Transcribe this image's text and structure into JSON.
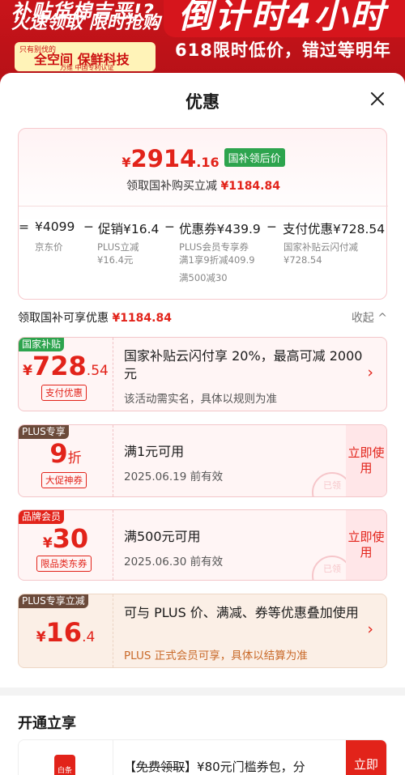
{
  "banner": {
    "left_line1": "补贴货棉吉恶!?",
    "left_line2": "火速领取 限时抢购",
    "shop_small": "只有别伐的",
    "shop_brand": "全空间 保鲜科技",
    "shop_sub": "万维 中国专利认证",
    "countdown": "倒计时4小时",
    "slogan": "618限时低价，错过等明年"
  },
  "sheet": {
    "title": "优惠"
  },
  "summary": {
    "price_symbol": "¥",
    "price_int": "2914",
    "price_dec": ".16",
    "price_tag": "国补领后价",
    "sub_text": "领取国补购买立减",
    "sub_amount": "¥1184.84",
    "formula": {
      "eq": "=",
      "jd_price": "¥4099",
      "minus1": "−",
      "promo": "促销¥16.4",
      "minus2": "−",
      "coupon": "优惠券¥439.9",
      "minus3": "−",
      "pay": "支付优惠¥728.54"
    },
    "notes": {
      "jd_price_label": "京东价",
      "promo_line1": "PLUS立减",
      "promo_line2": "¥16.4元",
      "coupon_line1": "PLUS会员专享券",
      "coupon_line2": "满1享9折减409.9",
      "coupon_line3": "满500减30",
      "pay_line1": "国家补贴云闪付减",
      "pay_line2": "¥728.54"
    }
  },
  "section": {
    "label": "领取国补可享优惠",
    "amount": "¥1184.84",
    "collapse": "收起 ^"
  },
  "coupons": [
    {
      "badge": "国家补贴",
      "badge_color": "#2da44e",
      "sym": "¥",
      "amount": "728",
      "dec": ".54",
      "tag": "支付优惠",
      "title": "国家补贴云闪付享 20%，最高可减 2000元",
      "subtitle": "该活动需实名，具体以规则为准",
      "chevron": "›"
    },
    {
      "badge": "PLUS专享",
      "badge_color": "#6b4a3a",
      "amount": "9",
      "unit": "折",
      "tag": "大促神券",
      "title": "满1元可用",
      "subtitle": "2025.06.19 前有效",
      "action": "立即使用",
      "stamp": "已领"
    },
    {
      "badge": "品牌会员",
      "badge_color": "#e2231a",
      "sym": "¥",
      "amount": "30",
      "tag": "限品类东券",
      "title": "满500元可用",
      "subtitle": "2025.06.30 前有效",
      "action": "立即使用",
      "stamp": "已领"
    },
    {
      "badge": "PLUS专享立减",
      "badge_color": "#6b4a3a",
      "sym": "¥",
      "amount": "16",
      "dec": ".4",
      "title": "可与 PLUS 价、满减、券等优惠叠加使用",
      "subtitle": "PLUS 正式会员可享，具体以结算为准",
      "chevron": "›"
    }
  ],
  "open": {
    "title": "开通立享",
    "icon_label": "白条",
    "text_prefix": "【",
    "text_strike": "免费领取",
    "text_suffix": "】¥80元门槛券包，分",
    "button": "立即"
  }
}
